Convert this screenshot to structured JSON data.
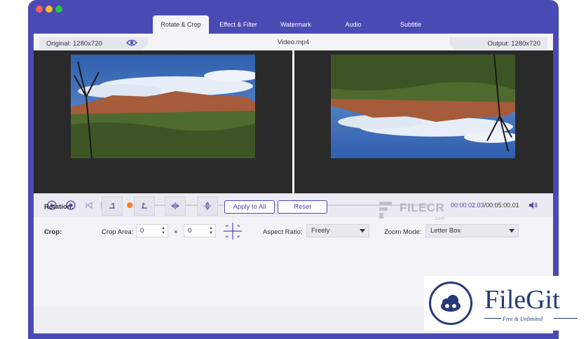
{
  "tabs": [
    {
      "label": "Rotate & Crop",
      "active": true
    },
    {
      "label": "Effect & Filter",
      "active": false
    },
    {
      "label": "Watermark",
      "active": false
    },
    {
      "label": "Audio",
      "active": false
    },
    {
      "label": "Subtitle",
      "active": false
    }
  ],
  "info": {
    "original": "Original: 1280x720",
    "filename": "Video.mp4",
    "output": "Output: 1280x720"
  },
  "player": {
    "current_time": "00:00:02.03",
    "total_time": "/00:05:00.01",
    "progress": 0.02
  },
  "rotation": {
    "label": "Rotation:",
    "apply_label": "Apply to All",
    "reset_label": "Reset",
    "icons": [
      "rotate-left-icon",
      "rotate-right-icon",
      "flip-horizontal-icon",
      "flip-vertical-icon"
    ]
  },
  "crop": {
    "label": "Crop:",
    "area_label": "Crop Area:",
    "width_value": "0",
    "times": "×",
    "height_value": "0",
    "aspect_label": "Aspect Ratio:",
    "aspect_value": "Freely",
    "zoom_label": "Zoom Mode:",
    "zoom_value": "Letter Box"
  },
  "watermarks": {
    "filecr": "FILECR",
    "filecr_sub": ".com",
    "filegit": "FileGit",
    "filegit_tag": "Free & Unlimited"
  },
  "colors": {
    "accent": "#4a4ab4",
    "progress_thumb": "#ff7a1a",
    "brand_blue": "#263a7a"
  }
}
